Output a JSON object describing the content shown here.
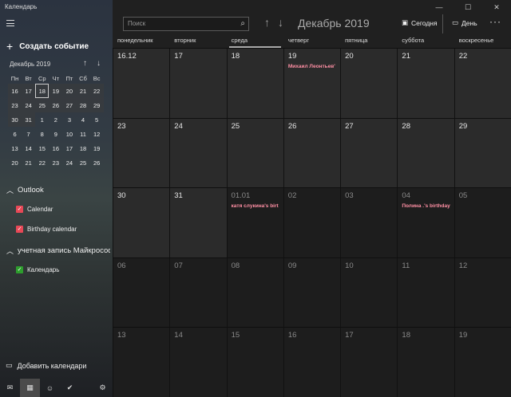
{
  "app": {
    "title": "Календарь"
  },
  "sidebar": {
    "new_event": "Создать событие",
    "mini_calendar": {
      "title": "Декабрь 2019",
      "weekdays": [
        "Пн",
        "Вт",
        "Ср",
        "Чт",
        "Пт",
        "Сб",
        "Вс"
      ],
      "rows": [
        [
          "16",
          "17",
          "18",
          "19",
          "20",
          "21",
          "22"
        ],
        [
          "23",
          "24",
          "25",
          "26",
          "27",
          "28",
          "29"
        ],
        [
          "30",
          "31",
          "1",
          "2",
          "3",
          "4",
          "5"
        ],
        [
          "6",
          "7",
          "8",
          "9",
          "10",
          "11",
          "12"
        ],
        [
          "13",
          "14",
          "15",
          "16",
          "17",
          "18",
          "19"
        ],
        [
          "20",
          "21",
          "22",
          "23",
          "24",
          "25",
          "26"
        ]
      ]
    },
    "groups": [
      {
        "label": "Outlook",
        "items": [
          {
            "label": "Calendar",
            "color": "#e74856"
          },
          {
            "label": "Birthday calendar",
            "color": "#e74856"
          }
        ]
      },
      {
        "label": "учетная запись Майкрософт",
        "items": [
          {
            "label": "Календарь",
            "color": "#2d9e2d"
          }
        ]
      }
    ],
    "add_calendars": "Добавить календари"
  },
  "toolbar": {
    "search_placeholder": "Поиск",
    "month_title": "Декабрь 2019",
    "today_label": "Сегодня",
    "day_label": "День"
  },
  "weekdays": [
    "понедельник",
    "вторник",
    "среда",
    "четверг",
    "пятница",
    "суббота",
    "воскресенье"
  ],
  "weeks": [
    [
      {
        "d": "16.12"
      },
      {
        "d": "17"
      },
      {
        "d": "18"
      },
      {
        "d": "19",
        "ev": "Михаил Леонтьев'"
      },
      {
        "d": "20"
      },
      {
        "d": "21"
      },
      {
        "d": "22"
      }
    ],
    [
      {
        "d": "23"
      },
      {
        "d": "24"
      },
      {
        "d": "25"
      },
      {
        "d": "26"
      },
      {
        "d": "27"
      },
      {
        "d": "28"
      },
      {
        "d": "29"
      }
    ],
    [
      {
        "d": "30"
      },
      {
        "d": "31"
      },
      {
        "d": "01.01",
        "out": true,
        "ev": "катя слукина's birt"
      },
      {
        "d": "02",
        "out": true
      },
      {
        "d": "03",
        "out": true
      },
      {
        "d": "04",
        "out": true,
        "ev": "Полина .'s birthday"
      },
      {
        "d": "05",
        "out": true
      }
    ],
    [
      {
        "d": "06",
        "out": true
      },
      {
        "d": "07",
        "out": true
      },
      {
        "d": "08",
        "out": true
      },
      {
        "d": "09",
        "out": true
      },
      {
        "d": "10",
        "out": true
      },
      {
        "d": "11",
        "out": true
      },
      {
        "d": "12",
        "out": true
      }
    ],
    [
      {
        "d": "13",
        "out": true
      },
      {
        "d": "14",
        "out": true
      },
      {
        "d": "15",
        "out": true
      },
      {
        "d": "16",
        "out": true
      },
      {
        "d": "17",
        "out": true
      },
      {
        "d": "18",
        "out": true
      },
      {
        "d": "19",
        "out": true
      }
    ]
  ]
}
